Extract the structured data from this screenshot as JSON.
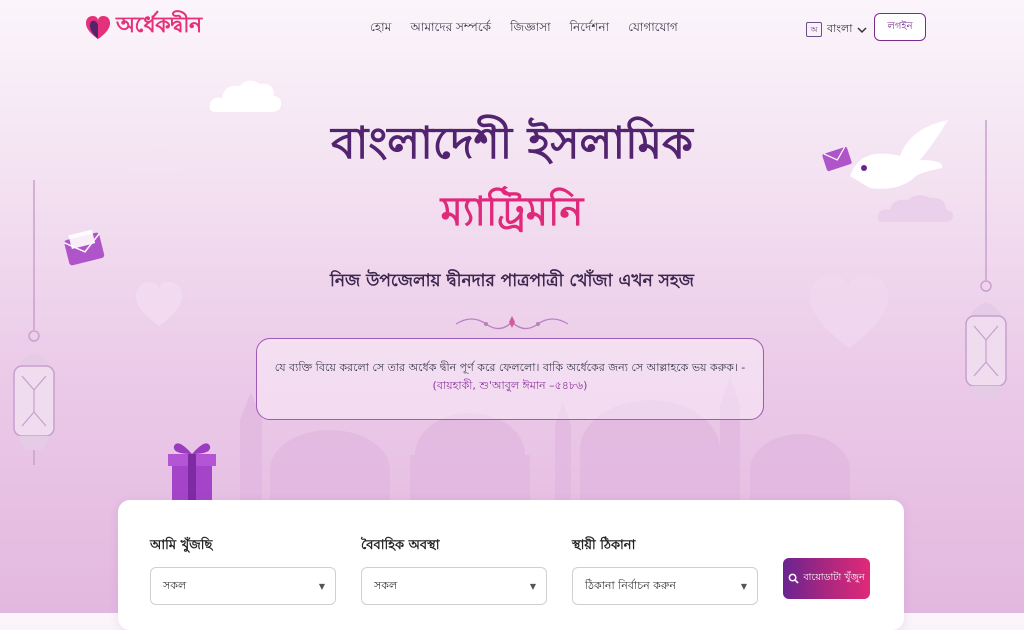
{
  "header": {
    "logo_text": "অর্ধেকদ্বীন",
    "nav": [
      "হোম",
      "আমাদের সম্পর্কে",
      "জিজ্ঞাসা",
      "নির্দেশনা",
      "যোগাযোগ"
    ],
    "language": "বাংলা",
    "login": "লগইন"
  },
  "hero": {
    "title": "বাংলাদেশী ইসলামিক",
    "subtitle": "ম্যাট্রিমনি",
    "tagline": "নিজ উপজেলায় দ্বীনদার পাত্রপাত্রী খোঁজা এখন সহজ"
  },
  "quote": {
    "text": "যে ব্যক্তি বিয়ে করলো সে তার অর্ধেক দ্বীন পূর্ণ করে ফেললো। বাকি অর্ধেকের জন্য সে আল্লাহকে ভয় করুক। -",
    "reference": "(বায়হাকী, শু'আবুল ঈমান –৫৪৮৬)"
  },
  "search": {
    "looking_for": {
      "label": "আমি খুঁজছি",
      "value": "সকল"
    },
    "marital_status": {
      "label": "বৈবাহিক অবস্থা",
      "value": "সকল"
    },
    "address": {
      "label": "স্থায়ী ঠিকানা",
      "value": "ঠিকানা নির্বাচন করুন"
    },
    "button": "বায়োডাটা খুঁজুন"
  },
  "colors": {
    "primary_purple": "#52236f",
    "accent_pink": "#e0297a",
    "border_purple": "#9c5cb4"
  }
}
